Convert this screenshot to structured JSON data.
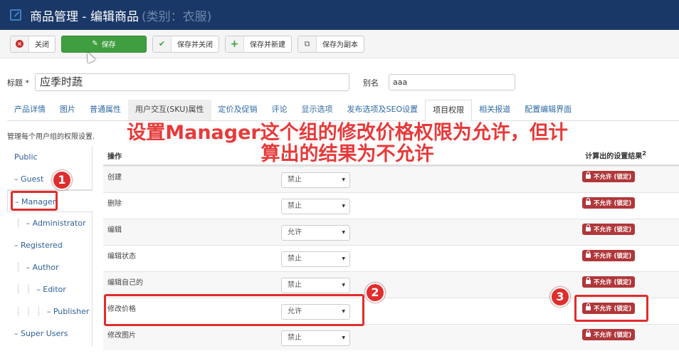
{
  "header": {
    "title": "商品管理 - 编辑商品",
    "subtitle": "(类别：衣服)",
    "icon": "edit-icon"
  },
  "toolbar": {
    "close_label": "关闭",
    "save_label": "保存",
    "save_close_label": "保存并关闭",
    "save_new_label": "保存并新建",
    "save_copy_label": "保存为副本"
  },
  "form": {
    "title_label": "标题 *",
    "title_value": "应季时蔬",
    "alias_label": "别名",
    "alias_value": "aaa"
  },
  "tabs": [
    {
      "label": "产品详情"
    },
    {
      "label": "图片"
    },
    {
      "label": "普通属性"
    },
    {
      "label": "用户交互(SKU)属性"
    },
    {
      "label": "定价及促销"
    },
    {
      "label": "评论"
    },
    {
      "label": "显示选项"
    },
    {
      "label": "发布选项及SEO设置"
    },
    {
      "label": "项目权限",
      "active": true
    },
    {
      "label": "相关报道"
    },
    {
      "label": "配置编辑界面"
    }
  ],
  "description": "管理每个用户组的权限设置.",
  "groups": [
    {
      "label": "Public"
    },
    {
      "label": "– Guest"
    },
    {
      "label": "– Manager",
      "selected": true
    },
    {
      "label": "– Administrator"
    },
    {
      "label": "– Registered"
    },
    {
      "label": "– Author"
    },
    {
      "label": "– Editor"
    },
    {
      "label": "– Publisher"
    },
    {
      "label": "– Super Users"
    }
  ],
  "table": {
    "col_action": "操作",
    "col_new": "选",
    "col_calc": "计算出的设置结果",
    "col_calc_sup": "2",
    "rows": [
      {
        "action": "创建",
        "setting": "禁止",
        "result": "不允许 (锁定)"
      },
      {
        "action": "删除",
        "setting": "禁止",
        "result": "不允许 (锁定)"
      },
      {
        "action": "编辑",
        "setting": "允许",
        "result": "不允许 (锁定)"
      },
      {
        "action": "编辑状态",
        "setting": "禁止",
        "result": "不允许 (锁定)"
      },
      {
        "action": "编辑自己的",
        "setting": "禁止",
        "result": "不允许 (锁定)"
      },
      {
        "action": "修改价格",
        "setting": "允许",
        "result": "不允许 (锁定)"
      },
      {
        "action": "修改图片",
        "setting": "禁止",
        "result": "不允许 (锁定)"
      }
    ]
  },
  "annotation": {
    "line1": "设置Manager这个组的修改价格权限为允许，但计",
    "line2": "算出的结果为不允许",
    "markers": [
      "1",
      "2",
      "3"
    ]
  },
  "colors": {
    "header_bg": "#1a3867",
    "save_green": "#3f9e3f",
    "badge_red": "#b0373a",
    "annotation_red": "#e02d2d"
  }
}
